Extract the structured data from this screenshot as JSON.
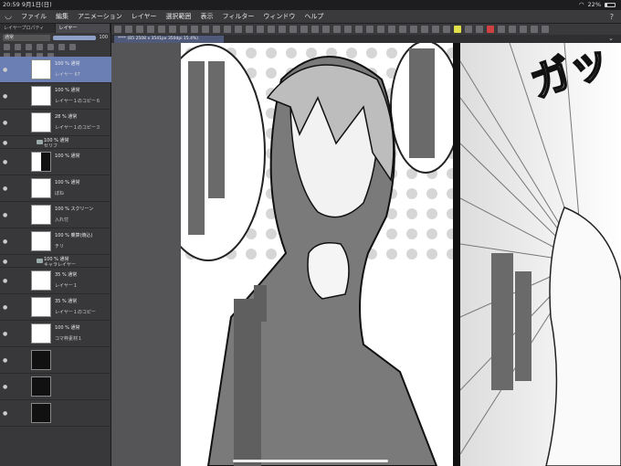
{
  "status": {
    "time": "20:59",
    "date": "9月1日(日)",
    "battery": "22%"
  },
  "menu": [
    "ファイル",
    "編集",
    "アニメーション",
    "レイヤー",
    "選択範囲",
    "表示",
    "フィルター",
    "ウィンドウ",
    "ヘルプ"
  ],
  "panel": {
    "tabs": [
      "レイヤープロパティ",
      "レイヤー"
    ],
    "blend_mode": "通常",
    "opacity": "100",
    "opacity_fraction": 1.0
  },
  "layers": [
    {
      "opacity": "100 % 通常",
      "name": "レイヤー 67",
      "selected": true
    },
    {
      "opacity": "100 % 通常",
      "name": "レイヤー１のコピー６"
    },
    {
      "opacity": "28 % 通常",
      "name": "レイヤー１のコピー３"
    },
    {
      "opacity": "100 % 通常",
      "name": "セリフ",
      "folder": true
    },
    {
      "opacity": "100 % 通常",
      "name": ""
    },
    {
      "opacity": "100 % 通常",
      "name": "ぼね"
    },
    {
      "opacity": "100 % スクリーン",
      "name": "入れ付"
    },
    {
      "opacity": "100 % 乗算(焼込)",
      "name": "チリ"
    },
    {
      "opacity": "100 % 通常",
      "name": "キャラレイヤー",
      "folder": true
    },
    {
      "opacity": "35 % 通常",
      "name": "レイヤー１"
    },
    {
      "opacity": "35 % 通常",
      "name": "レイヤー１のコピー"
    },
    {
      "opacity": "100 % 通常",
      "name": "コマ枠素材１"
    },
    {
      "opacity": "",
      "name": ""
    },
    {
      "opacity": "",
      "name": ""
    },
    {
      "opacity": "",
      "name": ""
    }
  ],
  "doc_tab": "**** (B5 2508 x 3541px 350dpi 15.4%)",
  "sfx": "ガッ"
}
